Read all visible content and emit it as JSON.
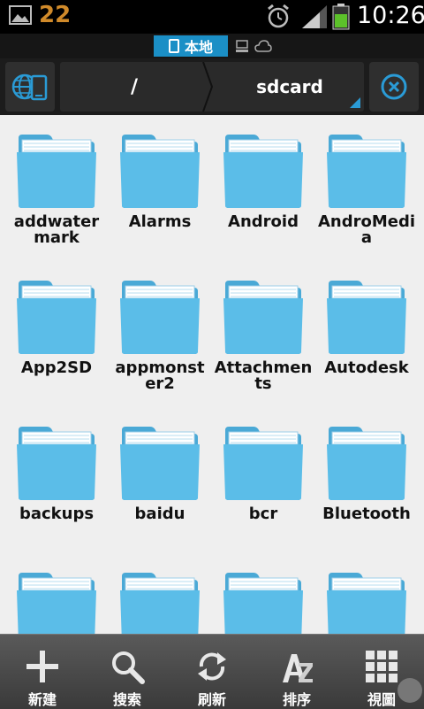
{
  "status_bar": {
    "notification_count": "22",
    "time": "10:26"
  },
  "tabs": {
    "local_label": "本地"
  },
  "path": {
    "root": "/",
    "current": "sdcard"
  },
  "folders": [
    {
      "name": "addwatermark"
    },
    {
      "name": "Alarms"
    },
    {
      "name": "Android"
    },
    {
      "name": "AndroMedia"
    },
    {
      "name": "App2SD"
    },
    {
      "name": "appmonster2"
    },
    {
      "name": "Attachments"
    },
    {
      "name": "Autodesk"
    },
    {
      "name": "backups"
    },
    {
      "name": "baidu"
    },
    {
      "name": "bcr"
    },
    {
      "name": "Bluetooth"
    },
    {
      "name": ""
    },
    {
      "name": ""
    },
    {
      "name": ""
    },
    {
      "name": ""
    }
  ],
  "toolbar": {
    "new_label": "新建",
    "search_label": "搜索",
    "refresh_label": "刷新",
    "sort_label": "排序",
    "view_label": "視圖"
  },
  "colors": {
    "folder_blue": "#5bbde8",
    "accent": "#1b8fc6"
  }
}
